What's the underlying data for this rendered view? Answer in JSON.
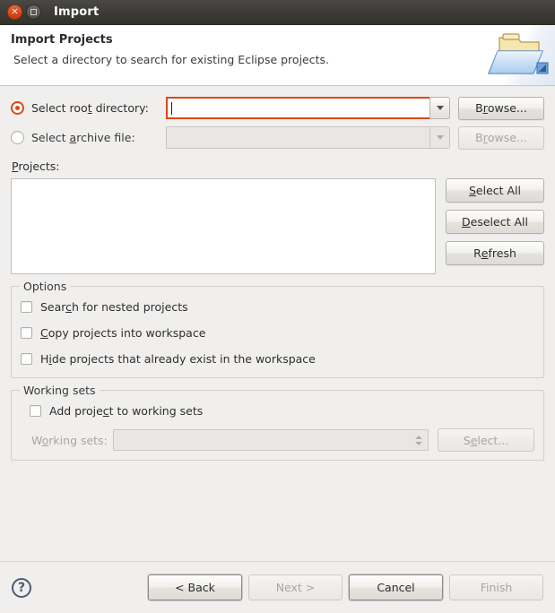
{
  "window": {
    "title": "Import",
    "close_icon": "close-icon",
    "maximize_icon": "maximize-icon"
  },
  "banner": {
    "title": "Import Projects",
    "subtitle": "Select a directory to search for existing Eclipse projects.",
    "icon": "import-folder-icon"
  },
  "source": {
    "root_directory": {
      "label_pre": "Select roo",
      "label_mnemonic": "t",
      "label_post": " directory:",
      "selected": true,
      "value": "",
      "browse_pre": "B",
      "browse_mnemonic": "r",
      "browse_post": "owse...",
      "dropdown_icon": "chevron-down-icon"
    },
    "archive_file": {
      "label_pre": "Select ",
      "label_mnemonic": "a",
      "label_post": "rchive file:",
      "selected": false,
      "value": "",
      "browse_pre": "B",
      "browse_mnemonic": "r",
      "browse_post": "owse...",
      "dropdown_icon": "chevron-down-icon"
    }
  },
  "projects": {
    "label_pre": "",
    "label_mnemonic": "P",
    "label_post": "rojects:",
    "items": [],
    "buttons": [
      {
        "pre": "",
        "mnemonic": "S",
        "post": "elect All",
        "name": "select-all-button"
      },
      {
        "pre": "",
        "mnemonic": "D",
        "post": "eselect All",
        "name": "deselect-all-button"
      },
      {
        "pre": "R",
        "mnemonic": "e",
        "post": "fresh",
        "name": "refresh-button"
      }
    ]
  },
  "options": {
    "title": "Options",
    "checkboxes": [
      {
        "pre": "Sear",
        "mnemonic": "c",
        "post": "h for nested projects",
        "checked": false
      },
      {
        "pre": "",
        "mnemonic": "C",
        "post": "opy projects into workspace",
        "checked": false
      },
      {
        "pre": "H",
        "mnemonic": "i",
        "post": "de projects that already exist in the workspace",
        "checked": false
      }
    ]
  },
  "working_sets": {
    "title": "Working sets",
    "add_checkbox": {
      "pre": "Add proje",
      "mnemonic": "c",
      "post": "t to working sets",
      "checked": false
    },
    "label_pre": "W",
    "label_mnemonic": "o",
    "label_post": "rking sets:",
    "value": "",
    "select_pre": "S",
    "select_mnemonic": "e",
    "select_post": "lect...",
    "enabled": false
  },
  "footer": {
    "help_icon": "help-icon",
    "buttons": [
      {
        "label": "< Back",
        "enabled": true,
        "name": "back-button"
      },
      {
        "label": "Next >",
        "enabled": false,
        "name": "next-button"
      },
      {
        "label": "Cancel",
        "enabled": true,
        "name": "cancel-button"
      },
      {
        "label": "Finish",
        "enabled": false,
        "name": "finish-button"
      }
    ]
  },
  "colors": {
    "accent": "#dd4814",
    "titlebar": "#3b3a36",
    "body_bg": "#f0efee",
    "help": "#4a5b74"
  }
}
